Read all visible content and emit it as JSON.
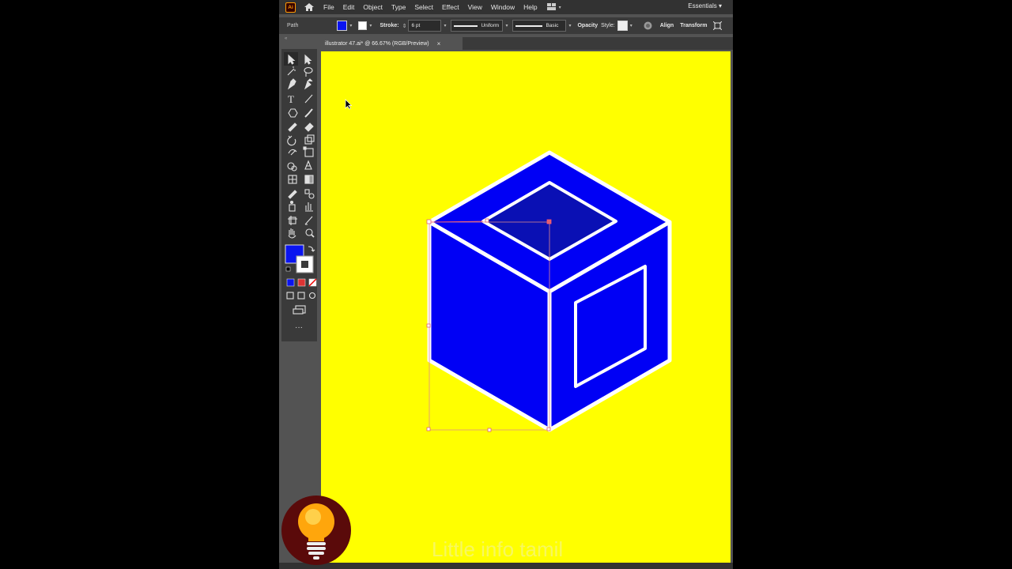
{
  "menubar": {
    "logo": "Ai",
    "items": [
      "File",
      "Edit",
      "Object",
      "Type",
      "Select",
      "Effect",
      "View",
      "Window",
      "Help"
    ],
    "workspace": "Essentials"
  },
  "controlbar": {
    "selection_type": "Path",
    "stroke_label": "Stroke:",
    "stroke_weight": "6 pt",
    "profile": "Uniform",
    "brush": "Basic",
    "opacity_label": "Opacity",
    "style_label": "Style:",
    "align_label": "Align",
    "transform_label": "Transform",
    "fill_color": "#0a14f0"
  },
  "document": {
    "tab_title": "illustrator 47.ai* @ 66.67% (RGB/Preview)",
    "close": "×"
  },
  "toolbar": {
    "icons": [
      "selection-tool-icon",
      "direct-selection-tool-icon",
      "magic-wand-icon",
      "lasso-icon",
      "pen-tool-icon",
      "curvature-tool-icon",
      "type-tool-icon",
      "line-tool-icon",
      "shape-tool-icon",
      "paintbrush-icon",
      "pencil-icon",
      "eraser-icon",
      "rotate-tool-icon",
      "scale-tool-icon",
      "warp-tool-icon",
      "free-transform-icon",
      "shape-builder-icon",
      "perspective-grid-icon",
      "mesh-tool-icon",
      "gradient-tool-icon",
      "eyedropper-icon",
      "blend-tool-icon",
      "symbol-sprayer-icon",
      "graph-tool-icon",
      "artboard-tool-icon",
      "slice-tool-icon",
      "hand-tool-icon",
      "zoom-tool-icon"
    ],
    "fill_color": "#0a14f0",
    "stroke_color": "#ffffff",
    "more": "···"
  },
  "canvas": {
    "background": "#ffff00",
    "cube_front_color": "#0000f5",
    "cube_hole_color": "#0a10b4",
    "outline_color": "#ffffff"
  },
  "overlay": {
    "watermark": "Little info tamil"
  }
}
